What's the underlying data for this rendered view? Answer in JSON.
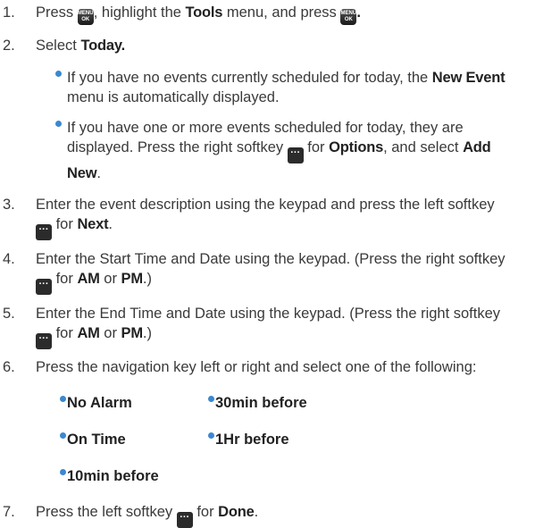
{
  "steps": [
    {
      "num": "1.",
      "a": "Press ",
      "b": ", highlight the ",
      "c": "Tools",
      "d": " menu, and press ",
      "e": "."
    },
    {
      "num": "2.",
      "a": "Select ",
      "b": "Today",
      "c": "."
    },
    {
      "num": "3.",
      "line1": "Enter the event description using the keypad and press the left softkey",
      "a": " for ",
      "b": "Next",
      "c": "."
    },
    {
      "num": "4.",
      "line1": "Enter the Start Time and Date using the keypad. (Press the right softkey",
      "a": " for ",
      "b": "AM",
      "c": " or ",
      "d": "PM",
      "e": ".)"
    },
    {
      "num": "5.",
      "line1": "Enter the End Time and Date using the keypad. (Press the right softkey",
      "a": " for ",
      "b": "AM",
      "c": " or ",
      "d": "PM",
      "e": ".)"
    },
    {
      "num": "6.",
      "text": "Press the navigation key left or right and select one of the following:"
    },
    {
      "num": "7.",
      "a": "Press the left softkey ",
      "b": " for ",
      "c": "Done",
      "d": "."
    }
  ],
  "bullets": [
    {
      "a": "If you have no events currently scheduled for today, the ",
      "b": "New Event",
      "line2": "menu is automatically displayed."
    },
    {
      "line1": "If you have one or more events scheduled for today, they are",
      "a": "displayed. Press the right softkey ",
      "b": " for ",
      "c": "Options",
      "d": ", and select ",
      "e": "Add",
      "f": "New",
      "g": "."
    }
  ],
  "options": [
    "No Alarm",
    "30min before",
    "On Time",
    "1Hr before",
    "10min before"
  ],
  "keys": {
    "menu_top": "MENU",
    "menu_bottom": "OK",
    "softkey_glyph": "···"
  },
  "colors": {
    "bullet": "#3b88d0",
    "text": "#3a3a3a"
  }
}
